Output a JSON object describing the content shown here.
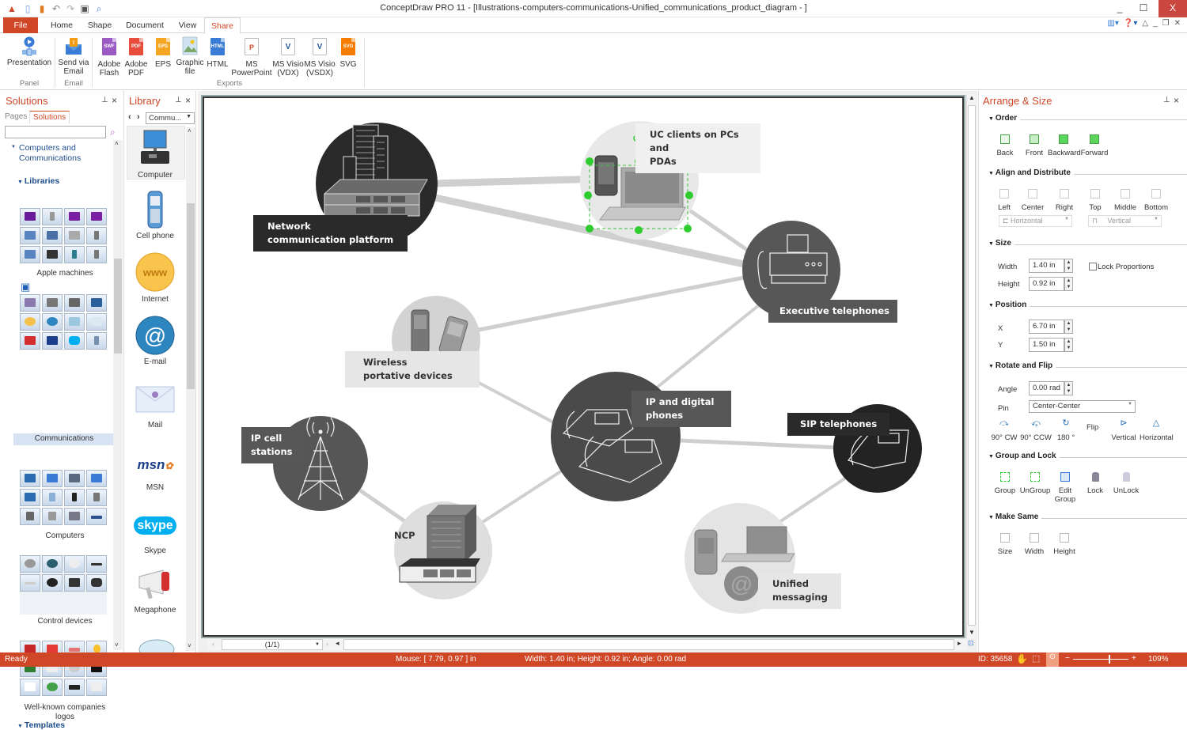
{
  "app": {
    "title": "ConceptDraw PRO 11 - [Illustrations-computers-communications-Unified_communications_product_diagram - ]",
    "quick_access": [
      "app-logo-icon",
      "new-document-icon",
      "open-icon",
      "undo-icon",
      "redo-icon",
      "save-icon",
      "print-preview-icon"
    ],
    "window_controls": {
      "minimize": "_",
      "maximize": "☐",
      "close": "X"
    }
  },
  "ribbon": {
    "tabs": [
      {
        "label": "File",
        "active": false
      },
      {
        "label": "Home",
        "active": false
      },
      {
        "label": "Shape",
        "active": false
      },
      {
        "label": "Document",
        "active": false
      },
      {
        "label": "View",
        "active": false
      },
      {
        "label": "Share",
        "active": true
      }
    ],
    "groups": [
      {
        "label": "Panel",
        "buttons": [
          {
            "label": "Presentation",
            "icon": "presentation-icon"
          }
        ]
      },
      {
        "label": "Email",
        "buttons": [
          {
            "label": "Send via Email",
            "icon": "email-send-icon"
          }
        ]
      },
      {
        "label": "Exports",
        "buttons": [
          {
            "label": "Adobe Flash",
            "icon": "swf-icon",
            "badge": "SWF",
            "color": "#9b59c4"
          },
          {
            "label": "Adobe PDF",
            "icon": "pdf-icon",
            "badge": "PDF",
            "color": "#e84c3d"
          },
          {
            "label": "EPS",
            "icon": "eps-icon",
            "badge": "EPS",
            "color": "#f5a623"
          },
          {
            "label": "Graphic file",
            "icon": "image-file-icon",
            "badge": "",
            "color": "#7cb7e0"
          },
          {
            "label": "HTML",
            "icon": "html-icon",
            "badge": "HTML",
            "color": "#3a7bd5"
          },
          {
            "label": "MS PowerPoint",
            "icon": "powerpoint-icon",
            "badge": "P",
            "color": "#d24726"
          },
          {
            "label": "MS Visio (VDX)",
            "icon": "visio-vdx-icon",
            "badge": "V",
            "color": "#2b5797"
          },
          {
            "label": "MS Visio (VSDX)",
            "icon": "visio-vsdx-icon",
            "badge": "V",
            "color": "#2b5797"
          },
          {
            "label": "SVG",
            "icon": "svg-icon",
            "badge": "SVG",
            "color": "#f57c00"
          }
        ]
      }
    ]
  },
  "solutions": {
    "title": "Solutions",
    "tabs": [
      {
        "label": "Pages",
        "active": false
      },
      {
        "label": "Solutions",
        "active": true
      }
    ],
    "search_value": "",
    "tree_root": "Computers and Communications",
    "libraries_header": "Libraries",
    "libraries": [
      {
        "label": "Apple machines"
      },
      {
        "label": "Communications",
        "selected": true
      },
      {
        "label": "Computers"
      },
      {
        "label": "Control devices"
      },
      {
        "label": "Well-known companies logos"
      }
    ],
    "templates_header": "Templates"
  },
  "library": {
    "title": "Library",
    "dropdown_value": "Commu...",
    "items": [
      {
        "label": "Computer",
        "icon": "computer-icon"
      },
      {
        "label": "Cell phone",
        "icon": "cell-phone-icon"
      },
      {
        "label": "Internet",
        "icon": "www-icon"
      },
      {
        "label": "E-mail",
        "icon": "at-sign-icon"
      },
      {
        "label": "Mail",
        "icon": "envelope-icon"
      },
      {
        "label": "MSN",
        "icon": "msn-logo-icon"
      },
      {
        "label": "Skype",
        "icon": "skype-logo-icon"
      },
      {
        "label": "Megaphone",
        "icon": "megaphone-icon"
      }
    ]
  },
  "diagram": {
    "nodes": [
      {
        "id": "ncp-platform",
        "label_lines": [
          "Network",
          "communication platform"
        ],
        "icon": "buildings-switch-icon"
      },
      {
        "id": "uc-clients",
        "label_lines": [
          "UC clients on PCs and",
          "PDAs"
        ],
        "icon": "laptop-pda-icon",
        "selected": true
      },
      {
        "id": "exec-phones",
        "label_lines": [
          "Executive telephones"
        ],
        "icon": "fax-phone-icon"
      },
      {
        "id": "wireless",
        "label_lines": [
          "Wireless",
          "portative devices"
        ],
        "icon": "mobile-phones-icon"
      },
      {
        "id": "ip-digital",
        "label_lines": [
          "IP and digital",
          "phones"
        ],
        "icon": "desk-phones-icon"
      },
      {
        "id": "sip",
        "label_lines": [
          "SIP telephones"
        ],
        "icon": "sip-phone-icon"
      },
      {
        "id": "ip-cell",
        "label_lines": [
          "IP cell",
          "stations"
        ],
        "icon": "cell-tower-icon"
      },
      {
        "id": "ncp",
        "label_lines": [
          "NCP"
        ],
        "icon": "building-switch-icon"
      },
      {
        "id": "unified",
        "label_lines": [
          "Unified",
          "messaging"
        ],
        "icon": "phone-laptop-email-icon"
      }
    ],
    "page_indicator": "(1/1)"
  },
  "arrange": {
    "title": "Arrange & Size",
    "order": {
      "header": "Order",
      "buttons": [
        "Back",
        "Front",
        "Backward",
        "Forward"
      ]
    },
    "align": {
      "header": "Align and Distribute",
      "buttons": [
        "Left",
        "Center",
        "Right",
        "Top",
        "Middle",
        "Bottom"
      ],
      "horizontal": "Horizontal",
      "vertical": "Vertical"
    },
    "size": {
      "header": "Size",
      "width_label": "Width",
      "width": "1.40 in",
      "height_label": "Height",
      "height": "0.92 in",
      "lock_label": "Lock Proportions",
      "lock_checked": false
    },
    "position": {
      "header": "Position",
      "x_label": "X",
      "x": "6.70 in",
      "y_label": "Y",
      "y": "1.50 in"
    },
    "rotate": {
      "header": "Rotate and Flip",
      "angle_label": "Angle",
      "angle": "0.00 rad",
      "pin_label": "Pin",
      "pin": "Center-Center",
      "buttons": [
        "90° CW",
        "90° CCW",
        "180 °",
        "Flip",
        "Vertical",
        "Horizontal"
      ]
    },
    "group": {
      "header": "Group and Lock",
      "buttons": [
        "Group",
        "UnGroup",
        "Edit Group",
        "Lock",
        "UnLock"
      ]
    },
    "same": {
      "header": "Make Same",
      "buttons": [
        "Size",
        "Width",
        "Height"
      ]
    }
  },
  "status": {
    "ready": "Ready",
    "mouse": "Mouse: [ 7.79, 0.97 ] in",
    "dims": "Width: 1.40 in;  Height: 0.92 in;  Angle: 0.00 rad",
    "id": "ID: 35658",
    "zoom": "109%",
    "zoom_percent": 109
  }
}
